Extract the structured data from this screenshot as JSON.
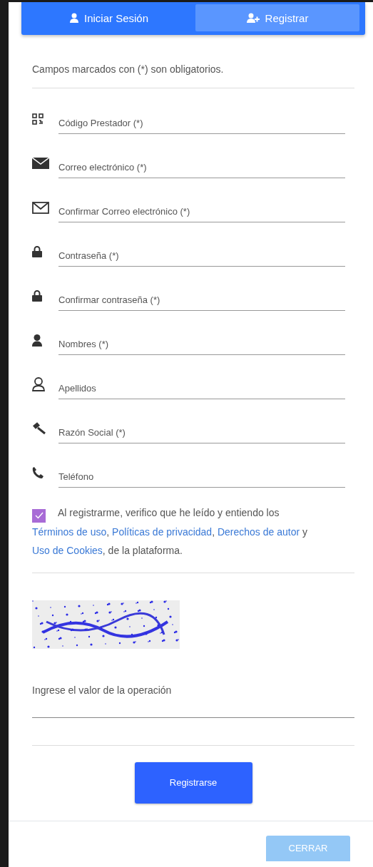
{
  "tabs": [
    {
      "label": "Iniciar Sesión",
      "selected": false
    },
    {
      "label": "Registrar",
      "selected": true
    }
  ],
  "notice": "Campos marcados con (*) son obligatorios.",
  "fields": [
    {
      "placeholder": "Código Prestador (*)"
    },
    {
      "placeholder": "Correo electrónico (*)"
    },
    {
      "placeholder": "Confirmar Correo electrónico (*)"
    },
    {
      "placeholder": "Contraseña (*)"
    },
    {
      "placeholder": "Confirmar contraseña (*)"
    },
    {
      "placeholder": "Nombres (*)"
    },
    {
      "placeholder": "Apellidos"
    },
    {
      "placeholder": "Razón Social (*)"
    },
    {
      "placeholder": "Teléfono"
    }
  ],
  "consent": {
    "checked": true,
    "parts": [
      {
        "kind": "text",
        "text": "Al registrarme, verifico que he leído y entiendo los "
      },
      {
        "kind": "link",
        "text": "Términos de uso"
      },
      {
        "kind": "text",
        "text": ", "
      },
      {
        "kind": "link",
        "text": "Políticas de privacidad"
      },
      {
        "kind": "text",
        "text": ", "
      },
      {
        "kind": "link",
        "text": "Derechos de autor"
      },
      {
        "kind": "text",
        "text": " y "
      },
      {
        "kind": "link",
        "text": "Uso de Cookies"
      },
      {
        "kind": "text",
        "text": ", de la plataforma."
      }
    ]
  },
  "answer": {
    "placeholder": "Ingrese el valor de la operación"
  },
  "submit_button": "Registrarse",
  "close_button": "CERRAR"
}
